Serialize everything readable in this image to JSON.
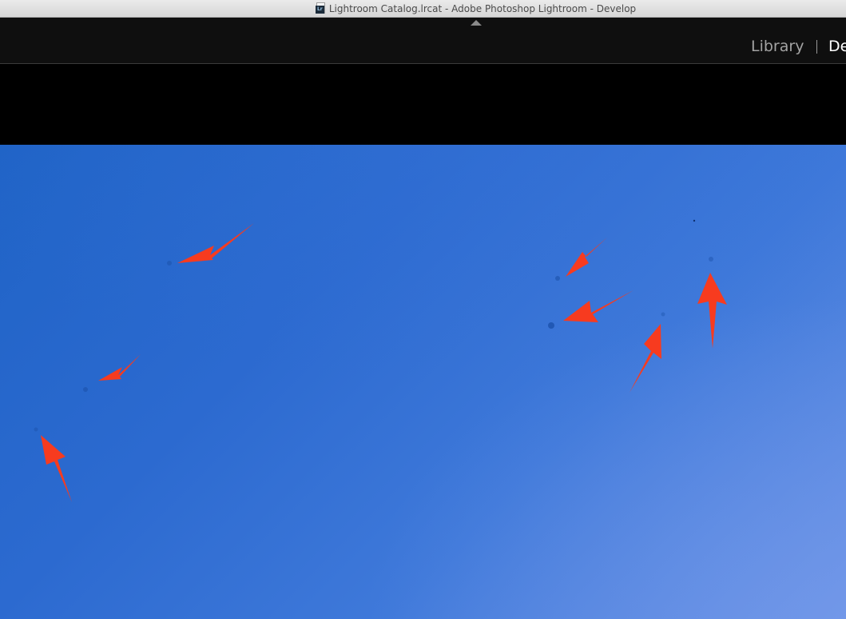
{
  "window": {
    "title": "Lightroom Catalog.lrcat - Adobe Photoshop Lightroom - Develop",
    "doc_icon_badge": "Lr"
  },
  "module_picker": {
    "modules": [
      {
        "label": "Library",
        "active": false
      },
      {
        "label": "De",
        "active": true
      }
    ]
  },
  "icons": {
    "panel_toggle": "triangle-up-icon",
    "document": "lrcat-document-icon"
  },
  "photo": {
    "content": "blue sky with sensor dust spots marked by red arrows",
    "arrow_color": "#f73b1f",
    "sky_colors": [
      "#1f63c6",
      "#3f79da",
      "#6a93e6"
    ]
  }
}
